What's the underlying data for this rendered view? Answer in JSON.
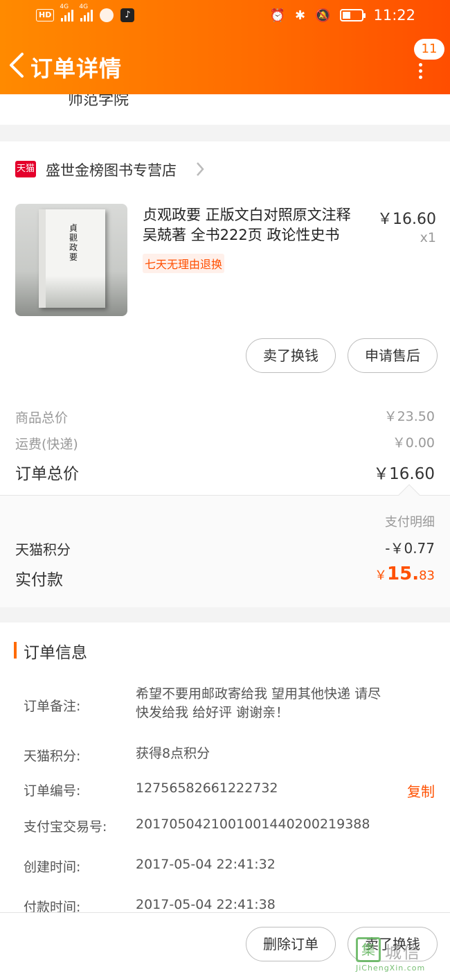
{
  "status_bar": {
    "hd": "HD",
    "sig1": "4G",
    "sig2": "4G",
    "time": "11:22"
  },
  "nav": {
    "title": "订单详情",
    "badge_count": "11"
  },
  "address_tail": "师范学院",
  "store": {
    "badge": "天猫",
    "name": "盛世金榜图书专营店"
  },
  "product": {
    "title": "贞观政要 正版文白对照原文注释 吴兢著 全书222页 政论性史书",
    "cover_text": "貞觀政要",
    "price": "￥16.60",
    "qty": "x1",
    "tag": "七天无理由退换"
  },
  "item_actions": {
    "sell": "卖了换钱",
    "after_sale": "申请售后"
  },
  "summary": {
    "goods_label": "商品总价",
    "goods_value": "￥23.50",
    "shipping_label": "运费(快递)",
    "shipping_value": "￥0.00",
    "total_label": "订单总价",
    "total_value": "￥16.60"
  },
  "payment": {
    "detail_label": "支付明细",
    "points_label": "天猫积分",
    "points_value": "-￥0.77",
    "paid_label": "实付款",
    "paid_currency": "￥",
    "paid_int": "15.",
    "paid_dec": "83"
  },
  "order_info": {
    "title": "订单信息",
    "note_label": "订单备注:",
    "note_value": "希望不要用邮政寄给我 望用其他快递 请尽快发给我 给好评 谢谢亲！",
    "points_label": "天猫积分:",
    "points_value": "获得8点积分",
    "order_no_label": "订单编号:",
    "order_no_value": "12756582661222732",
    "copy": "复制",
    "alipay_label": "支付宝交易号:",
    "alipay_value": "2017050421001001440200219388",
    "created_label": "创建时间:",
    "created_value": "2017-05-04 22:41:32",
    "paid_label": "付款时间:",
    "paid_value": "2017-05-04 22:41:38"
  },
  "bottom_bar": {
    "delete": "删除订单",
    "sell": "卖了换钱"
  },
  "watermark": {
    "box": "集",
    "cn": "城信",
    "en": "JiChengXin.com"
  },
  "colors": {
    "header_start": "#ff8a00",
    "header_end": "#ff4e00",
    "accent": "#ff5000",
    "tmall_red": "#e4002b"
  }
}
